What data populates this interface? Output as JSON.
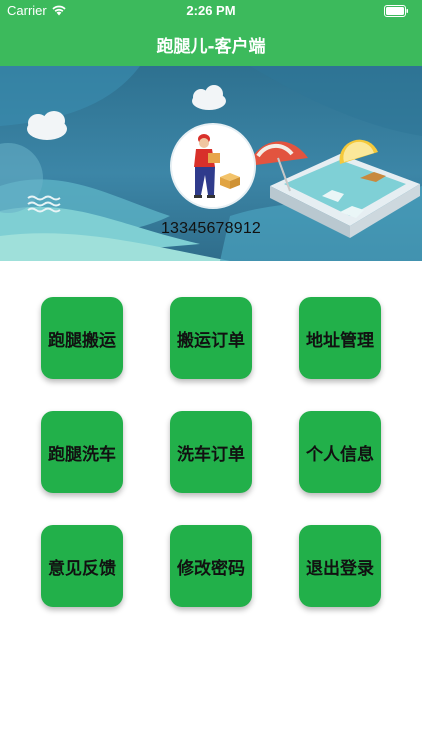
{
  "status_bar": {
    "carrier": "Carrier",
    "time": "2:26 PM"
  },
  "nav": {
    "title": "跑腿儿-客户端"
  },
  "profile": {
    "phone": "13345678912"
  },
  "menu": [
    {
      "label": "跑腿搬运"
    },
    {
      "label": "搬运订单"
    },
    {
      "label": "地址管理"
    },
    {
      "label": "跑腿洗车"
    },
    {
      "label": "洗车订单"
    },
    {
      "label": "个人信息"
    },
    {
      "label": "意见反馈"
    },
    {
      "label": "修改密码"
    },
    {
      "label": "退出登录"
    }
  ],
  "colors": {
    "header": "#3cba5c",
    "tile": "#22b04a"
  }
}
